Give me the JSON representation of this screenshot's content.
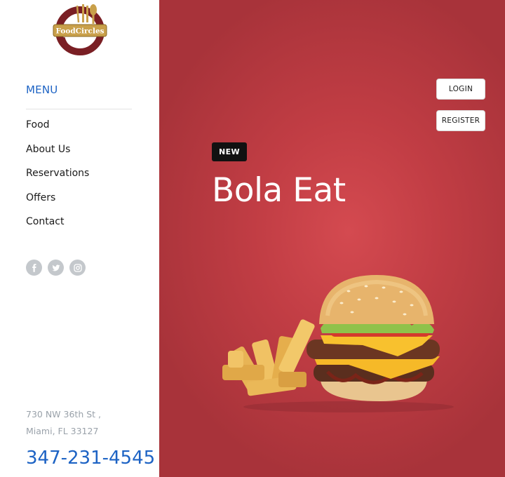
{
  "brand": {
    "logo_text": "FoodCircles"
  },
  "sidebar": {
    "menu_heading": "MENU",
    "nav_items": [
      {
        "label": "Food"
      },
      {
        "label": "About Us"
      },
      {
        "label": "Reservations"
      },
      {
        "label": "Offers"
      },
      {
        "label": "Contact"
      }
    ],
    "social": [
      {
        "icon": "facebook-icon",
        "glyph": "f"
      },
      {
        "icon": "twitter-icon",
        "glyph": "bird"
      },
      {
        "icon": "instagram-icon",
        "glyph": "camera"
      }
    ],
    "address_line1": "730 NW 36th St ,",
    "address_line2": "Miami, FL 33127",
    "phone": "347-231-4545"
  },
  "header": {
    "login_label": "LOGIN",
    "register_label": "REGISTER"
  },
  "hero": {
    "badge": "NEW",
    "title": "Bola Eat"
  },
  "colors": {
    "accent": "#1d63c4",
    "hero_background": "#c13d44",
    "badge_background": "#111111"
  }
}
